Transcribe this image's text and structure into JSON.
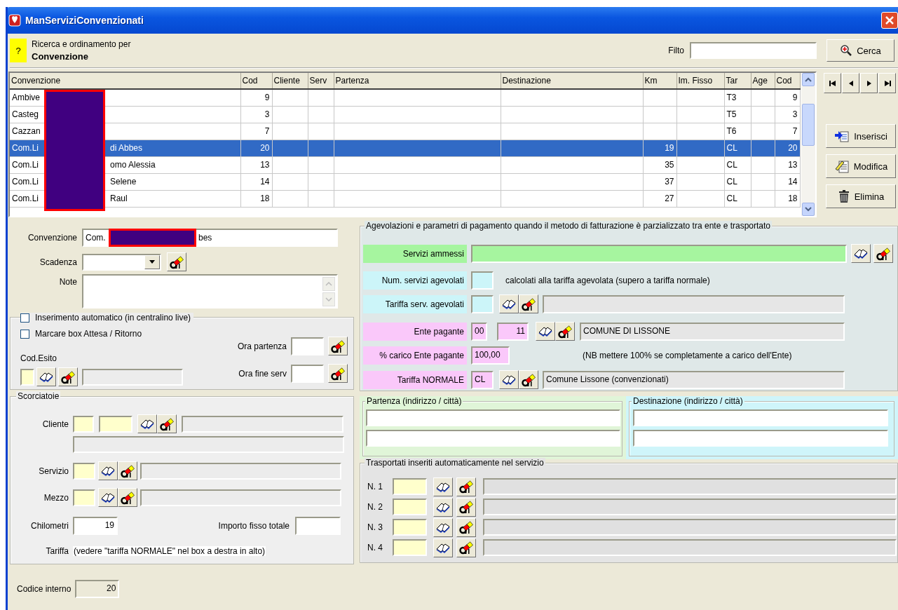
{
  "window": {
    "title": "ManServiziConvenzionati"
  },
  "search_header": {
    "help": "?",
    "caption": "Ricerca e ordinamento per",
    "sort_field": "Convenzione",
    "filter_label": "Filto",
    "search_button": "Cerca"
  },
  "table": {
    "columns": [
      {
        "label": "Convenzione"
      },
      {
        "label": "Cod"
      },
      {
        "label": "Cliente"
      },
      {
        "label": "Serv"
      },
      {
        "label": "Partenza"
      },
      {
        "label": "Destinazione"
      },
      {
        "label": "Km"
      },
      {
        "label": "Im. Fisso"
      },
      {
        "label": "Tar"
      },
      {
        "label": "Age"
      },
      {
        "label": "Cod"
      }
    ],
    "rows": [
      {
        "convenzione": [
          "Ambive"
        ],
        "cod": "9",
        "tar": "T3",
        "cod_2": "9",
        "selected": false
      },
      {
        "convenzione": [
          "Casteg"
        ],
        "cod": "3",
        "tar": "T5",
        "cod_2": "3",
        "selected": false
      },
      {
        "convenzione": [
          "Cazzan"
        ],
        "cod": "7",
        "tar": "T6",
        "cod_2": "7",
        "selected": false
      },
      {
        "convenzione": [
          "Com.Li",
          "di Abbes"
        ],
        "cod": "20",
        "km": "19",
        "tar": "CL",
        "cod_2": "20",
        "selected": true
      },
      {
        "convenzione": [
          "Com.Li",
          "omo Alessia"
        ],
        "cod": "13",
        "km": "35",
        "tar": "CL",
        "cod_2": "13",
        "selected": false
      },
      {
        "convenzione": [
          "Com.Li",
          "Selene"
        ],
        "cod": "14",
        "km": "37",
        "tar": "CL",
        "cod_2": "14",
        "selected": false
      },
      {
        "convenzione": [
          "Com.Li",
          "Raul"
        ],
        "cod": "18",
        "km": "27",
        "tar": "CL",
        "cod_2": "18",
        "selected": false
      }
    ]
  },
  "actions": [
    {
      "label": "Inserisci",
      "kind": "insert"
    },
    {
      "label": "Modifica",
      "kind": "edit"
    },
    {
      "label": "Elimina",
      "kind": "delete"
    }
  ],
  "form": {
    "convenzione": {
      "label": "Convenzione",
      "value_parts": [
        "Com.",
        "bes"
      ]
    },
    "scadenza": {
      "label": "Scadenza"
    },
    "note": {
      "label": "Note"
    }
  },
  "options": {
    "checkboxes": [
      {
        "label": "Inserimento automatico (in centralino live)",
        "checked": false
      },
      {
        "label": "Marcare box Attesa / Ritorno",
        "checked": false
      }
    ],
    "ora_partenza": "Ora partenza",
    "ora_fine": "Ora fine serv",
    "cod_esito": "Cod.Esito"
  },
  "agevolazioni": {
    "title": "Agevolazioni e parametri di pagamento quando il metodo di fatturazione è parzializzato tra ente e trasportato",
    "servizi_ammessi": {
      "label": "Servizi ammessi"
    },
    "num_servizi": {
      "label": "Num. servizi agevolati",
      "note": "calcolati alla tariffa agevolata (supero a tariffa normale)"
    },
    "tariffa_agevolati": {
      "label": "Tariffa serv. agevolati"
    },
    "ente_pagante": {
      "label": "Ente pagante",
      "code": "00",
      "number": "11",
      "name": "COMUNE DI LISSONE"
    },
    "carico": {
      "label": "% carico Ente pagante",
      "value": "100,00",
      "note": "(NB mettere 100% se completamente a carico dell'Ente)"
    },
    "tariffa_normale": {
      "label": "Tariffa NORMALE",
      "code": "CL",
      "description": "Comune Lissone (convenzionati)"
    }
  },
  "scorciatoie": {
    "title": "Scorciatoie",
    "cliente": "Cliente",
    "servizio": "Servizio",
    "mezzo": "Mezzo",
    "chilometri": {
      "label": "Chilometri",
      "value": "19"
    },
    "importo": "Importo fisso totale",
    "tariffa": {
      "label": "Tariffa",
      "note": "(vedere \"tariffa NORMALE\" nel box a destra in alto)"
    }
  },
  "partenza": {
    "title": "Partenza (indirizzo / città)"
  },
  "destinazione": {
    "title": "Destinazione (indirizzo / città)"
  },
  "trasportati": {
    "title": "Trasportati inseriti automaticamente nel servizio",
    "items": [
      "N. 1",
      "N. 2",
      "N. 3",
      "N. 4"
    ]
  },
  "codice_interno": {
    "label": "Codice interno",
    "value": "20"
  }
}
